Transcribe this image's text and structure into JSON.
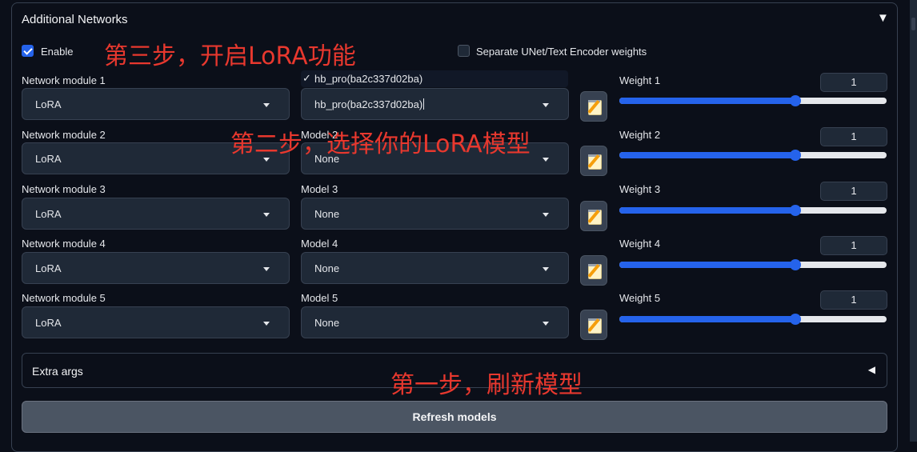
{
  "section": {
    "title": "Additional Networks"
  },
  "enable": {
    "label": "Enable",
    "checked": true
  },
  "separate_weights": {
    "label": "Separate UNet/Text Encoder weights",
    "checked": false
  },
  "rows": [
    {
      "module_label": "Network module 1",
      "module_value": "LoRA",
      "model_label": "",
      "model_value": "hb_pro(ba2c337d02ba)",
      "weight_label": "Weight 1",
      "weight_value": "1",
      "weight_fraction": 0.66
    },
    {
      "module_label": "Network module 2",
      "module_value": "LoRA",
      "model_label": "Model 2",
      "model_value": "None",
      "weight_label": "Weight 2",
      "weight_value": "1",
      "weight_fraction": 0.66
    },
    {
      "module_label": "Network module 3",
      "module_value": "LoRA",
      "model_label": "Model 3",
      "model_value": "None",
      "weight_label": "Weight 3",
      "weight_value": "1",
      "weight_fraction": 0.66
    },
    {
      "module_label": "Network module 4",
      "module_value": "LoRA",
      "model_label": "Model 4",
      "model_value": "None",
      "weight_label": "Weight 4",
      "weight_value": "1",
      "weight_fraction": 0.66
    },
    {
      "module_label": "Network module 5",
      "module_value": "LoRA",
      "model_label": "Model 5",
      "model_value": "None",
      "weight_label": "Weight 5",
      "weight_value": "1",
      "weight_fraction": 0.66
    }
  ],
  "model_dropdown_option": {
    "check": "✓",
    "text": "hb_pro(ba2c337d02ba)"
  },
  "extra_args": {
    "label": "Extra args",
    "arrow": "◀"
  },
  "refresh": {
    "label": "Refresh models"
  },
  "collapse_arrow": "▼",
  "annotations": {
    "step3": "第三步，开启LoRA功能",
    "step2": "第二步，选择你的LoRA模型",
    "step1": "第一步，刷新模型"
  },
  "colors": {
    "accent": "#2563eb",
    "annotation": "#e8382e",
    "background": "#0b0f19"
  }
}
